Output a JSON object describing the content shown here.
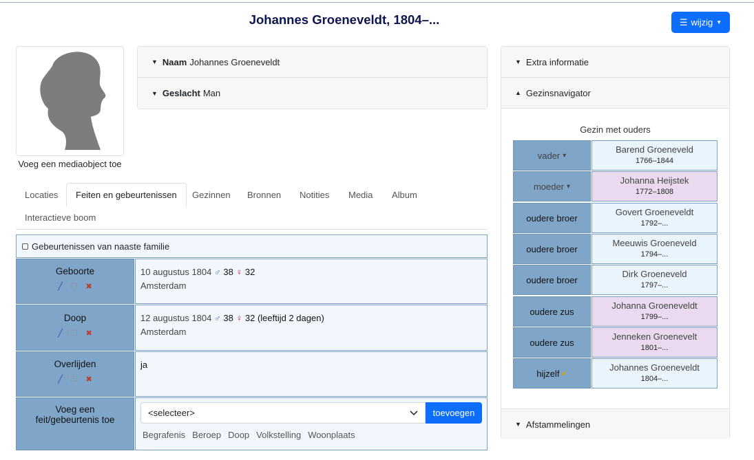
{
  "header": {
    "title": "Johannes Groeneveldt, 1804–...",
    "edit_button": "wijzig"
  },
  "media": {
    "caption": "Voeg een mediaobject toe"
  },
  "summary": [
    {
      "label": "Naam",
      "value": "Johannes Groeneveldt"
    },
    {
      "label": "Geslacht",
      "value": "Man"
    }
  ],
  "tabs": [
    {
      "label": "Locaties"
    },
    {
      "label": "Feiten en gebeurtenissen"
    },
    {
      "label": "Gezinnen"
    },
    {
      "label": "Bronnen"
    },
    {
      "label": "Notities"
    },
    {
      "label": "Media"
    },
    {
      "label": "Album"
    },
    {
      "label": "Interactieve boom"
    }
  ],
  "events": {
    "family_toggle": "Gebeurtenissen van naaste familie",
    "rows": [
      {
        "type": "Geboorte",
        "date": "10 augustus 1804",
        "father_age": "38",
        "mother_age": "32",
        "extra": "",
        "place": "Amsterdam"
      },
      {
        "type": "Doop",
        "date": "12 augustus 1804",
        "father_age": "38",
        "mother_age": "32",
        "extra": "(leeftijd 2 dagen)",
        "place": "Amsterdam"
      },
      {
        "type": "Overlijden",
        "value": "ja"
      }
    ],
    "add_label": "Voeg een feit/gebeurtenis toe",
    "select_value": "<selecteer>",
    "add_button": "toevoegen",
    "quick_links": [
      "Begrafenis",
      "Beroep",
      "Doop",
      "Volkstelling",
      "Woonplaats"
    ]
  },
  "sidebar": {
    "sections": [
      "Extra informatie",
      "Gezinsnavigator",
      "Afstammelingen"
    ],
    "family_title": "Gezin met ouders",
    "family": [
      {
        "role": "vader",
        "name": "Barend Groeneveld",
        "dates": "1766–1844",
        "sex": "m"
      },
      {
        "role": "moeder",
        "name": "Johanna Heijstek",
        "dates": "1772–1808",
        "sex": "f"
      },
      {
        "role": "oudere broer",
        "name": "Govert Groeneveldt",
        "dates": "1792–...",
        "sex": "m"
      },
      {
        "role": "oudere broer",
        "name": "Meeuwis Groeneveld",
        "dates": "1794–...",
        "sex": "m"
      },
      {
        "role": "oudere broer",
        "name": "Dirk Groeneveld",
        "dates": "1797–...",
        "sex": "m"
      },
      {
        "role": "oudere zus",
        "name": "Johanna Groeneveldt",
        "dates": "1799–...",
        "sex": "f"
      },
      {
        "role": "oudere zus",
        "name": "Jenneken Groenevelt",
        "dates": "1801–...",
        "sex": "f"
      },
      {
        "role": "hijzelf",
        "name": "Johannes Groeneveldt",
        "dates": "1804–...",
        "sex": "m"
      }
    ]
  },
  "colors": {
    "primary": "#0d6efd",
    "label_bg": "#7fa5c9",
    "value_bg": "#f1f7fd",
    "female_bg": "#ead9ef",
    "title": "#0f1452"
  }
}
